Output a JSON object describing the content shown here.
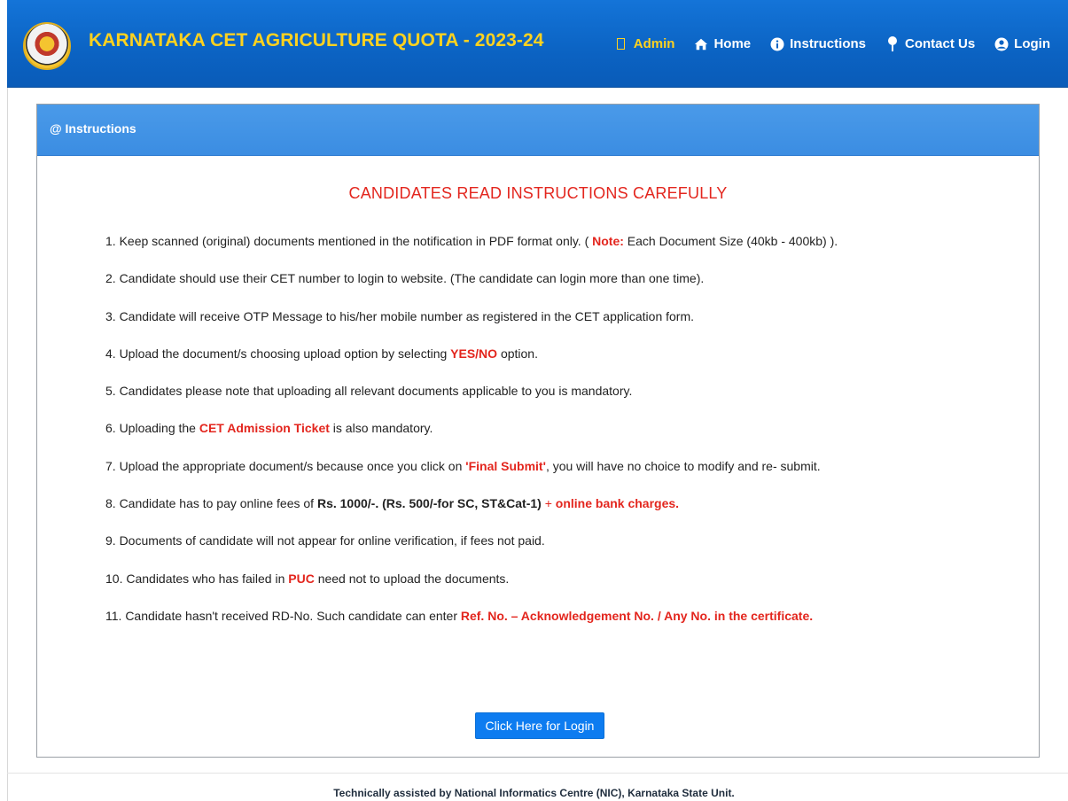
{
  "header": {
    "brand": "KARNATAKA CET AGRICULTURE QUOTA - 2023-24",
    "nav": {
      "admin": "Admin",
      "home": "Home",
      "instructions": "Instructions",
      "contact": "Contact Us",
      "login": "Login"
    },
    "colors": {
      "bar": "#0b63c3",
      "brand_text": "#ffd21f"
    }
  },
  "panel": {
    "title": "@ Instructions",
    "heading": "CANDIDATES READ INSTRUCTIONS CAREFULLY",
    "items": {
      "i1": {
        "a": "1. Keep scanned (original) documents mentioned in the notification in PDF format only. ( ",
        "b": "Note:",
        "c": " Each Document Size (40kb - 400kb) )."
      },
      "i2": {
        "a": "2. Candidate should use their CET number to login to website. (The candidate can login more than one time)."
      },
      "i3": {
        "a": "3. Candidate will receive OTP Message to his/her mobile number as registered in the CET application form."
      },
      "i4": {
        "a": "4. Upload the document/s choosing upload option by selecting ",
        "b": "YES/NO",
        "c": " option."
      },
      "i5": {
        "a": "5. Candidates please note that uploading all relevant documents applicable to you is mandatory."
      },
      "i6": {
        "a": "6. Uploading the ",
        "b": "CET Admission Ticket",
        "c": " is also mandatory."
      },
      "i7": {
        "a": "7. Upload the appropriate document/s because once you click on ",
        "b": "'Final Submit'",
        "c": ", you will have no choice to modify and re- submit."
      },
      "i8": {
        "a": "8. Candidate has to pay online fees of ",
        "b": "Rs. 1000/-. (Rs. 500/-for SC, ST&Cat-1)",
        "c": " + ",
        "d": "online bank charges."
      },
      "i9": {
        "a": "9. Documents of candidate will not appear for online verification, if fees not paid."
      },
      "i10": {
        "a": "10. Candidates who has failed in ",
        "b": "PUC",
        "c": " need not to upload the documents."
      },
      "i11": {
        "a": "11. Candidate hasn't received RD-No. Such candidate can enter ",
        "b": "Ref. No. – Acknowledgement No. / Any No. in the certificate."
      }
    },
    "login_button": "Click Here for Login",
    "colors": {
      "header": "#3b8de2",
      "emphasis": "#e3261e",
      "button": "#0d7cf0"
    }
  },
  "footer": {
    "text": "Technically assisted by National Informatics Centre (NIC), Karnataka State Unit."
  },
  "icons": [
    "emblem-logo",
    "admin-box-icon",
    "home-icon",
    "info-icon",
    "map-pin-icon",
    "user-circle-icon"
  ]
}
